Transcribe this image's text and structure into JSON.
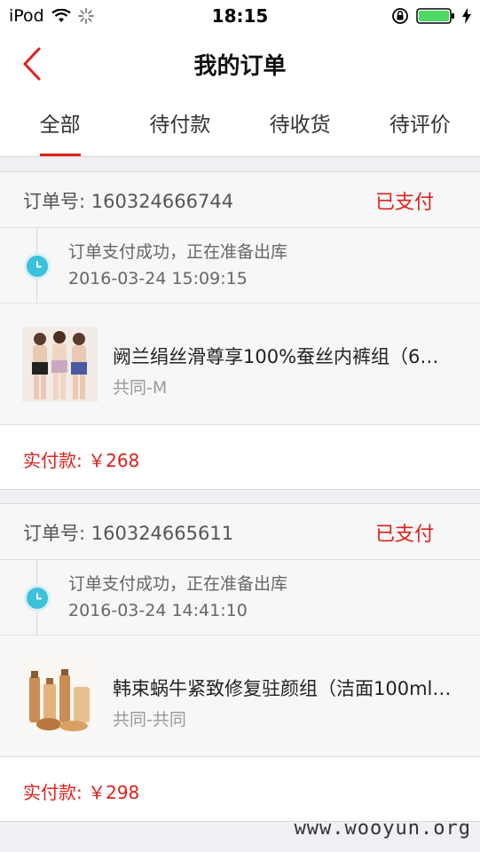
{
  "status_bar": {
    "carrier": "iPod",
    "time": "18:15",
    "icons": [
      "wifi-icon",
      "activity-spinner-icon",
      "orientation-lock-icon",
      "battery-icon",
      "charging-bolt-icon"
    ]
  },
  "nav": {
    "title": "我的订单",
    "back_icon": "chevron-left-icon"
  },
  "tabs": [
    {
      "label": "全部",
      "active": true
    },
    {
      "label": "待付款",
      "active": false
    },
    {
      "label": "待收货",
      "active": false
    },
    {
      "label": "待评价",
      "active": false
    }
  ],
  "orders": [
    {
      "order_no": "订单号: 160324666744",
      "status": "已支付",
      "track_msg": "订单支付成功，正在准备出库",
      "track_time": "2016-03-24 15:09:15",
      "product_name": "阙兰绢丝滑尊享100%蚕丝内裤组（6…",
      "spec": "共同-M",
      "paid": "实付款: ￥268"
    },
    {
      "order_no": "订单号: 160324665611",
      "status": "已支付",
      "track_msg": "订单支付成功，正在准备出库",
      "track_time": "2016-03-24 14:41:10",
      "product_name": "韩束蜗牛紧致修复驻颜组（洁面100ml…",
      "spec": "共同-共同",
      "paid": "实付款: ￥298"
    }
  ],
  "watermark": "www.wooyun.org",
  "colors": {
    "accent": "#e0201a",
    "timeline": "#3cc0dc",
    "background": "#efeff4"
  }
}
